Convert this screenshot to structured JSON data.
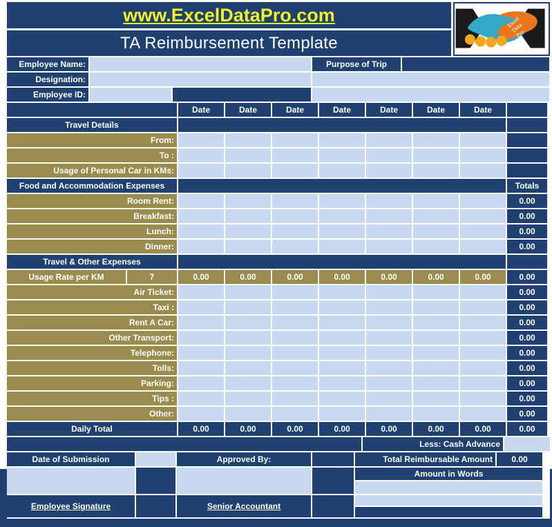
{
  "brand": {
    "url": "www.ExcelDataPro.com",
    "title": "TA Reimbursement Template",
    "url_color": "#f2f227",
    "navy": "#1f4170",
    "gold": "#9a8b4f",
    "input_blue": "#c6d9f1",
    "logo_name": "handshake-logo"
  },
  "employee": {
    "name_label": "Employee Name:",
    "name_value": "",
    "designation_label": "Designation:",
    "designation_value": "",
    "id_label": "Employee ID:",
    "id_value": "",
    "purpose_label": "Purpose of Trip",
    "purpose_value": ""
  },
  "columns": {
    "date_headers": [
      "Date",
      "Date",
      "Date",
      "Date",
      "Date",
      "Date",
      "Date"
    ],
    "totals_header": "Totals"
  },
  "sections": {
    "travel_details": "Travel Details",
    "food_accommodation": "Food and Accommodation Expenses",
    "travel_other": "Travel & Other Expenses"
  },
  "travel_rows": [
    {
      "label": "From:",
      "values": [
        "",
        "",
        "",
        "",
        "",
        "",
        ""
      ]
    },
    {
      "label": "To :",
      "values": [
        "",
        "",
        "",
        "",
        "",
        "",
        ""
      ]
    },
    {
      "label": "Usage of Personal Car in KMs:",
      "values": [
        "",
        "",
        "",
        "",
        "",
        "",
        ""
      ]
    }
  ],
  "food_rows": [
    {
      "label": "Room Rent:",
      "values": [
        "",
        "",
        "",
        "",
        "",
        "",
        ""
      ],
      "total": "0.00"
    },
    {
      "label": "Breakfast:",
      "values": [
        "",
        "",
        "",
        "",
        "",
        "",
        ""
      ],
      "total": "0.00"
    },
    {
      "label": "Lunch:",
      "values": [
        "",
        "",
        "",
        "",
        "",
        "",
        ""
      ],
      "total": "0.00"
    },
    {
      "label": "Dinner:",
      "values": [
        "",
        "",
        "",
        "",
        "",
        "",
        ""
      ],
      "total": "0.00"
    }
  ],
  "usage_rate": {
    "label": "Usage Rate per KM",
    "rate": "7",
    "values": [
      "0.00",
      "0.00",
      "0.00",
      "0.00",
      "0.00",
      "0.00",
      "0.00"
    ],
    "total": "0.00"
  },
  "expense_rows": [
    {
      "label": "Air Ticket:",
      "values": [
        "",
        "",
        "",
        "",
        "",
        "",
        ""
      ],
      "total": "0.00"
    },
    {
      "label": "Taxi :",
      "values": [
        "",
        "",
        "",
        "",
        "",
        "",
        ""
      ],
      "total": "0.00"
    },
    {
      "label": "Rent A Car:",
      "values": [
        "",
        "",
        "",
        "",
        "",
        "",
        ""
      ],
      "total": "0.00"
    },
    {
      "label": "Other Transport:",
      "values": [
        "",
        "",
        "",
        "",
        "",
        "",
        ""
      ],
      "total": "0.00"
    },
    {
      "label": "Telephone:",
      "values": [
        "",
        "",
        "",
        "",
        "",
        "",
        ""
      ],
      "total": "0.00"
    },
    {
      "label": "Tolls:",
      "values": [
        "",
        "",
        "",
        "",
        "",
        "",
        ""
      ],
      "total": "0.00"
    },
    {
      "label": "Parking:",
      "values": [
        "",
        "",
        "",
        "",
        "",
        "",
        ""
      ],
      "total": "0.00"
    },
    {
      "label": "Tips :",
      "values": [
        "",
        "",
        "",
        "",
        "",
        "",
        ""
      ],
      "total": "0.00"
    },
    {
      "label": "Other:",
      "values": [
        "",
        "",
        "",
        "",
        "",
        "",
        ""
      ],
      "total": "0.00"
    }
  ],
  "daily_total": {
    "label": "Daily Total",
    "values": [
      "0.00",
      "0.00",
      "0.00",
      "0.00",
      "0.00",
      "0.00",
      "0.00"
    ],
    "total": "0.00"
  },
  "summary": {
    "cash_advance_label": "Less: Cash Advance",
    "cash_advance_value": "",
    "total_reimbursable_label": "Total Reimbursable Amount",
    "total_reimbursable_value": "0.00",
    "amount_in_words_label": "Amount in Words",
    "amount_in_words_value": ""
  },
  "footer": {
    "date_of_submission_label": "Date of Submission",
    "date_of_submission_value": "",
    "approved_by_label": "Approved By:",
    "approved_by_value": "",
    "employee_signature_label": "Employee Signature",
    "senior_accountant_label": "Senior Accountant"
  }
}
